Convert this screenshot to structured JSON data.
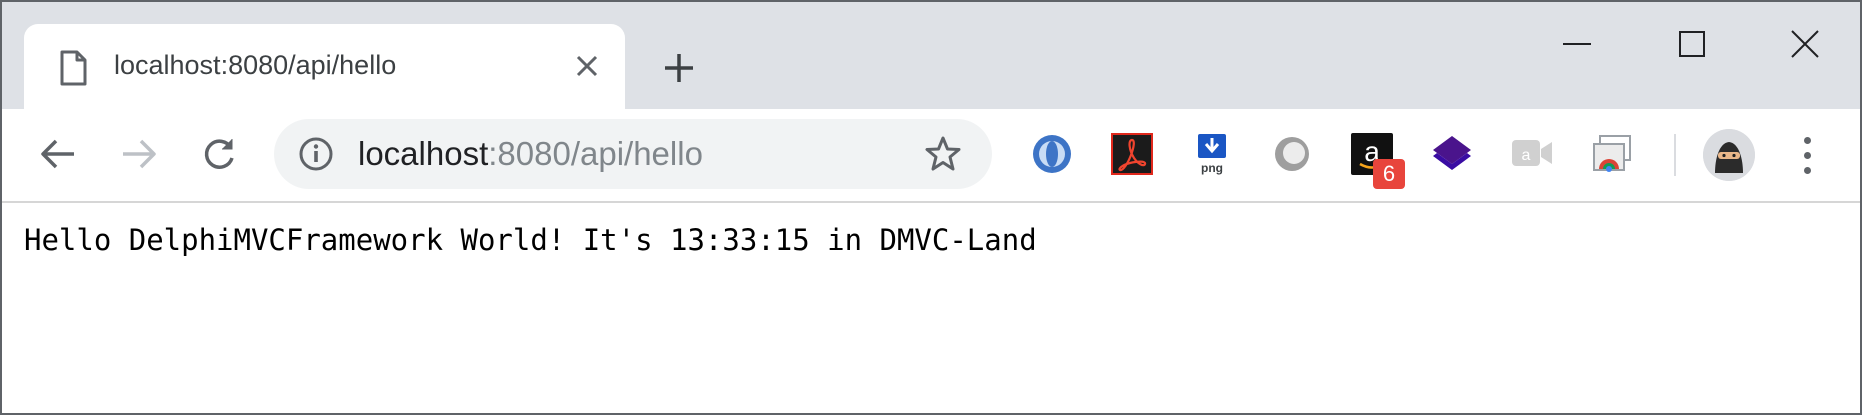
{
  "tab": {
    "title": "localhost:8080/api/hello",
    "close_icon": "close-icon",
    "page_icon": "page-icon"
  },
  "new_tab_icon": "plus-icon",
  "window_controls": [
    "minimize-icon",
    "maximize-icon",
    "close-icon"
  ],
  "toolbar": {
    "back_icon": "back-arrow-icon",
    "forward_icon": "forward-arrow-icon",
    "reload_icon": "reload-icon",
    "url_host": "localhost",
    "url_rest": ":8080/api/hello",
    "info_icon": "info-icon",
    "bookmark_icon": "star-icon"
  },
  "extensions": [
    {
      "name": "json-viewer-icon"
    },
    {
      "name": "acrobat-icon"
    },
    {
      "name": "png-download-icon"
    },
    {
      "name": "ring-icon"
    },
    {
      "name": "amazon-icon",
      "badge": "6"
    },
    {
      "name": "layers-icon"
    },
    {
      "name": "video-call-icon"
    },
    {
      "name": "cast-window-icon"
    }
  ],
  "profile_icon": "ninja-avatar-icon",
  "menu_icon": "more-vertical-icon",
  "colors": {
    "tabstrip_bg": "#dee1e6",
    "omnibox_bg": "#f1f3f4",
    "badge_red": "#e8453c",
    "layers_purple": "#4a148c"
  },
  "page": {
    "text": "Hello DelphiMVCFramework World! It's 13:33:15 in DMVC-Land"
  }
}
